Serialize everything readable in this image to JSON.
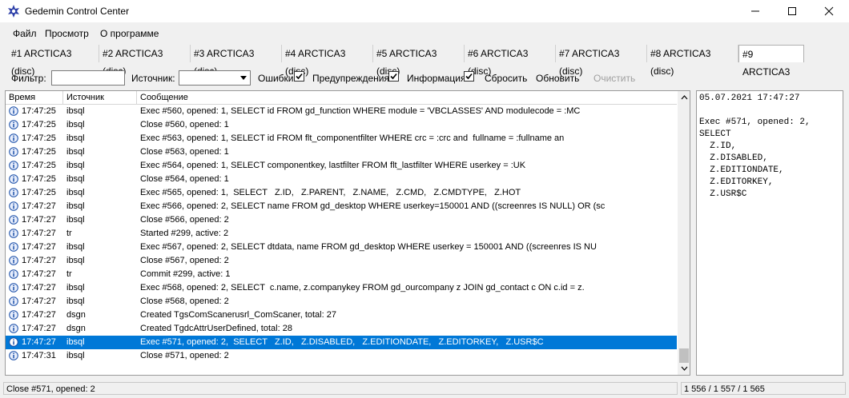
{
  "window": {
    "title": "Gedemin Control Center"
  },
  "menu": [
    "Файл",
    "Просмотр",
    "О программе"
  ],
  "tabs": [
    "#1 ARCTICA3 (disc)",
    "#2 ARCTICA3 (disc)",
    "#3 ARCTICA3 (disc)",
    "#4 ARCTICA3 (disc)",
    "#5 ARCTICA3 (disc)",
    "#6 ARCTICA3 (disc)",
    "#7 ARCTICA3 (disc)",
    "#8 ARCTICA3 (disc)",
    "#9 ARCTICA3"
  ],
  "active_tab": 8,
  "filter": {
    "filter_label": "Фильтр:",
    "filter_value": "",
    "source_label": "Источник:",
    "source_value": "",
    "errors_label": "Ошибки",
    "errors_checked": true,
    "warnings_label": "Предупреждения",
    "warnings_checked": true,
    "info_label": "Информация",
    "info_checked": true,
    "reset_label": "Сбросить",
    "refresh_label": "Обновить",
    "clear_label": "Очистить"
  },
  "columns": [
    "Время",
    "Источник",
    "Сообщение"
  ],
  "rows": [
    {
      "time": "17:47:25",
      "source": "ibsql",
      "message": "Exec #560, opened: 1, SELECT id FROM gd_function WHERE module = 'VBCLASSES' AND modulecode = :MC"
    },
    {
      "time": "17:47:25",
      "source": "ibsql",
      "message": "Close #560, opened: 1"
    },
    {
      "time": "17:47:25",
      "source": "ibsql",
      "message": "Exec #563, opened: 1, SELECT id FROM flt_componentfilter WHERE crc = :crc and  fullname = :fullname an"
    },
    {
      "time": "17:47:25",
      "source": "ibsql",
      "message": "Close #563, opened: 1"
    },
    {
      "time": "17:47:25",
      "source": "ibsql",
      "message": "Exec #564, opened: 1, SELECT componentkey, lastfilter FROM flt_lastfilter WHERE userkey = :UK"
    },
    {
      "time": "17:47:25",
      "source": "ibsql",
      "message": "Close #564, opened: 1"
    },
    {
      "time": "17:47:25",
      "source": "ibsql",
      "message": "Exec #565, opened: 1,  SELECT   Z.ID,   Z.PARENT,   Z.NAME,   Z.CMD,   Z.CMDTYPE,   Z.HOT"
    },
    {
      "time": "17:47:27",
      "source": "ibsql",
      "message": "Exec #566, opened: 2, SELECT name FROM gd_desktop WHERE userkey=150001 AND ((screenres IS NULL) OR (sc"
    },
    {
      "time": "17:47:27",
      "source": "ibsql",
      "message": "Close #566, opened: 2"
    },
    {
      "time": "17:47:27",
      "source": "tr",
      "message": "Started #299, active: 2"
    },
    {
      "time": "17:47:27",
      "source": "ibsql",
      "message": "Exec #567, opened: 2, SELECT dtdata, name FROM gd_desktop WHERE userkey = 150001 AND ((screenres IS NU"
    },
    {
      "time": "17:47:27",
      "source": "ibsql",
      "message": "Close #567, opened: 2"
    },
    {
      "time": "17:47:27",
      "source": "tr",
      "message": "Commit #299, active: 1"
    },
    {
      "time": "17:47:27",
      "source": "ibsql",
      "message": "Exec #568, opened: 2, SELECT  c.name, z.companykey FROM gd_ourcompany z JOIN gd_contact c ON c.id = z."
    },
    {
      "time": "17:47:27",
      "source": "ibsql",
      "message": "Close #568, opened: 2"
    },
    {
      "time": "17:47:27",
      "source": "dsgn",
      "message": "Created TgsComScanerusrl_ComScaner, total: 27"
    },
    {
      "time": "17:47:27",
      "source": "dsgn",
      "message": "Created TgdcAttrUserDefined, total: 28"
    },
    {
      "time": "17:47:27",
      "source": "ibsql",
      "message": "Exec #571, opened: 2,  SELECT   Z.ID,   Z.DISABLED,   Z.EDITIONDATE,   Z.EDITORKEY,   Z.USR$C"
    },
    {
      "time": "17:47:31",
      "source": "ibsql",
      "message": "Close #571, opened: 2"
    }
  ],
  "selected_row": 17,
  "detail_lines": [
    "05.07.2021 17:47:27",
    "",
    "Exec #571, opened: 2,",
    "SELECT",
    "  Z.ID,",
    "  Z.DISABLED,",
    "  Z.EDITIONDATE,",
    "  Z.EDITORKEY,",
    "  Z.USR$C"
  ],
  "status": {
    "message": "Close #571, opened: 2",
    "counts": "1 556 / 1 557 / 1 565"
  },
  "colors": {
    "selection": "#0078d7",
    "info_icon": "#1a4fa8"
  },
  "icons": {
    "row": "info-icon",
    "app": "star-logo-icon"
  }
}
